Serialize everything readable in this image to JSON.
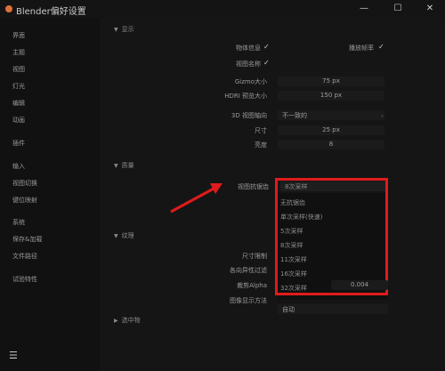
{
  "window": {
    "title": "Blender偏好设置",
    "minimize": "—",
    "maximize": "☐",
    "close": "✕"
  },
  "sidebar": {
    "items": [
      {
        "label": "界面"
      },
      {
        "label": "主题"
      },
      {
        "label": "视图"
      },
      {
        "label": "灯光"
      },
      {
        "label": "编辑"
      },
      {
        "label": "动画"
      },
      {
        "label": "插件"
      },
      {
        "label": "输入"
      },
      {
        "label": "视图切换"
      },
      {
        "label": "键位映射"
      },
      {
        "label": "系统"
      },
      {
        "label": "保存&加载"
      },
      {
        "label": "文件路径"
      },
      {
        "label": "试验特性"
      }
    ],
    "menu_icon": "hamburger-icon"
  },
  "sections": {
    "display": "显示",
    "quality": "质量",
    "texture": "纹理",
    "selection": "选中物"
  },
  "display": {
    "object_info": "物体信息",
    "view_name": "视图名称",
    "playback_fps": "播放帧率",
    "gizmo_label": "Gizmo大小",
    "gizmo_value": "75 px",
    "hdri_label": "HDRI 预览大小",
    "hdri_value": "150 px",
    "view3d_label": "3D 视图轴向",
    "view3d_value": "不一致的",
    "size_label": "尺寸",
    "size_value": "25 px",
    "brightness_label": "亮度",
    "brightness_value": "8"
  },
  "quality": {
    "aa_label": "视图抗锯齿",
    "aa_selected": "8次采样",
    "options": [
      "无抗锯齿",
      "单次采样(快速)",
      "5次采样",
      "8次采样",
      "11次采样",
      "16次采样",
      "32次采样"
    ]
  },
  "texture": {
    "limit_label": "尺寸限制",
    "aniso_label": "各向异性过滤",
    "clip_label": "裁剪Alpha",
    "display_label": "图像显示方法",
    "display_value": "自动",
    "extra_value": "0.004"
  }
}
